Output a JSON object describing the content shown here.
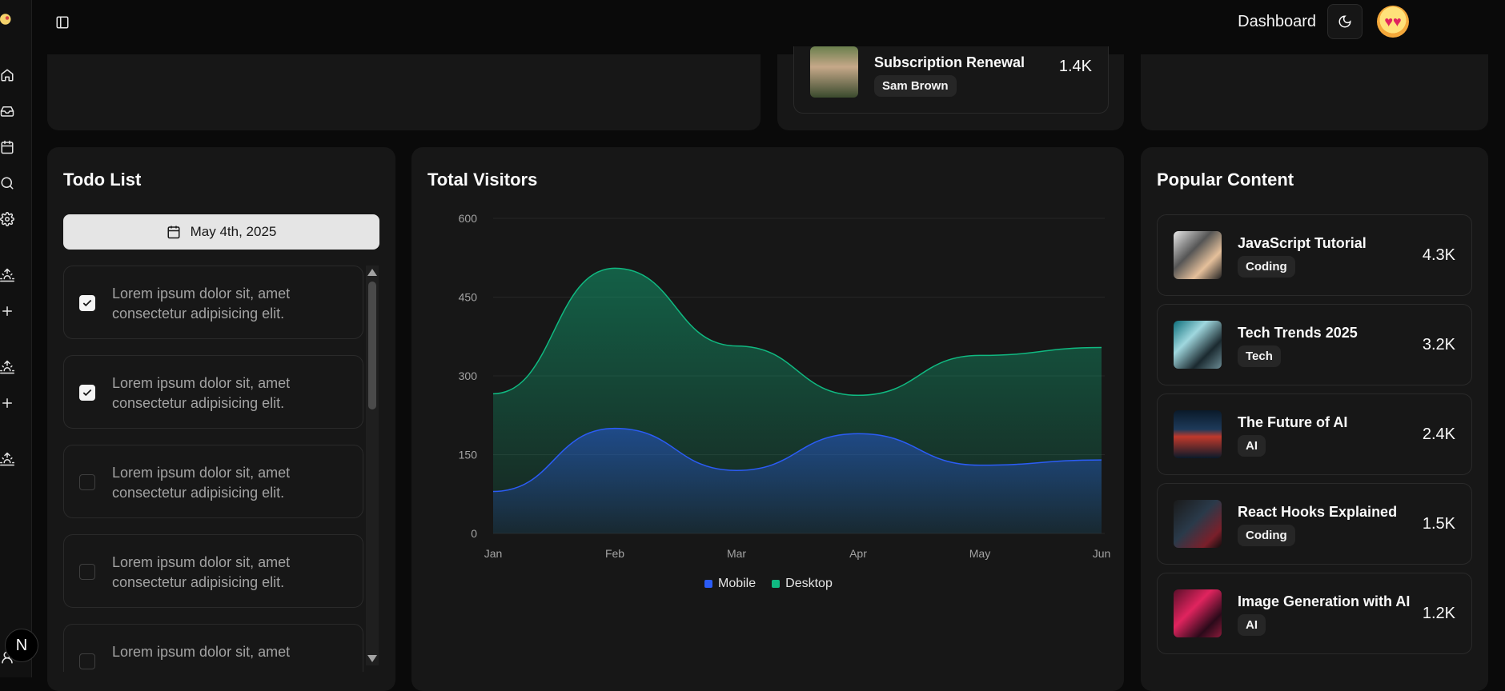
{
  "topbar": {
    "title": "Dashboard"
  },
  "subscription": {
    "title": "Subscription Renewal",
    "name": "Sam Brown",
    "value": "1.4K"
  },
  "todo": {
    "title": "Todo List",
    "date": "May 4th, 2025",
    "items": [
      {
        "text": "Lorem ipsum dolor sit, amet consectetur adipisicing elit.",
        "checked": true
      },
      {
        "text": "Lorem ipsum dolor sit, amet consectetur adipisicing elit.",
        "checked": true
      },
      {
        "text": "Lorem ipsum dolor sit, amet consectetur adipisicing elit.",
        "checked": false
      },
      {
        "text": "Lorem ipsum dolor sit, amet consectetur adipisicing elit.",
        "checked": false
      },
      {
        "text": "Lorem ipsum dolor sit, amet",
        "checked": false
      }
    ]
  },
  "visitors": {
    "title": "Total Visitors"
  },
  "chart_data": {
    "type": "area",
    "title": "Total Visitors",
    "categories": [
      "Jan",
      "Feb",
      "Mar",
      "Apr",
      "May",
      "Jun"
    ],
    "ylim": [
      0,
      600
    ],
    "yticks": [
      0,
      150,
      300,
      450,
      600
    ],
    "stacked": true,
    "series": [
      {
        "name": "Mobile",
        "values": [
          80,
          200,
          120,
          190,
          130,
          140
        ],
        "color": "#2b5cf6"
      },
      {
        "name": "Desktop",
        "values": [
          186,
          305,
          237,
          73,
          209,
          214
        ],
        "color": "#10b981"
      }
    ],
    "legend": "bottom",
    "grid": true
  },
  "popular": {
    "title": "Popular Content",
    "items": [
      {
        "title": "JavaScript Tutorial",
        "tag": "Coding",
        "value": "4.3K"
      },
      {
        "title": "Tech Trends 2025",
        "tag": "Tech",
        "value": "3.2K"
      },
      {
        "title": "The Future of AI",
        "tag": "AI",
        "value": "2.4K"
      },
      {
        "title": "React Hooks Explained",
        "tag": "Coding",
        "value": "1.5K"
      },
      {
        "title": "Image Generation with AI",
        "tag": "AI",
        "value": "1.2K"
      }
    ]
  },
  "badge": {
    "letter": "N"
  }
}
